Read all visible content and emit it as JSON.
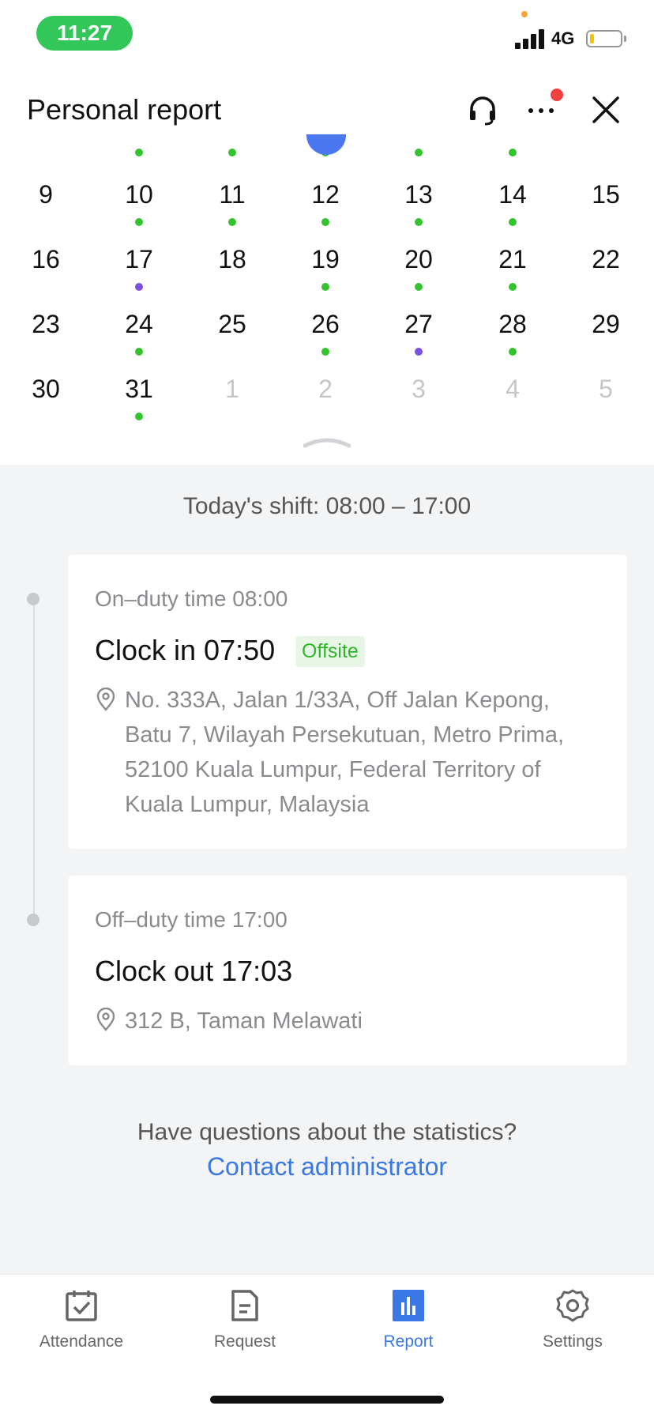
{
  "status_bar": {
    "time": "11:27",
    "network": "4G"
  },
  "header": {
    "title": "Personal report"
  },
  "calendar": {
    "rows": [
      [
        {
          "day": "9",
          "dot": null,
          "other": false
        },
        {
          "day": "10",
          "dot": "green",
          "other": false
        },
        {
          "day": "11",
          "dot": "green",
          "other": false
        },
        {
          "day": "12",
          "dot": "green",
          "other": false
        },
        {
          "day": "13",
          "dot": "green",
          "other": false
        },
        {
          "day": "14",
          "dot": "green",
          "other": false
        },
        {
          "day": "15",
          "dot": null,
          "other": false
        }
      ],
      [
        {
          "day": "16",
          "dot": null,
          "other": false
        },
        {
          "day": "17",
          "dot": "purple",
          "other": false
        },
        {
          "day": "18",
          "dot": null,
          "other": false
        },
        {
          "day": "19",
          "dot": "green",
          "other": false
        },
        {
          "day": "20",
          "dot": "green",
          "other": false
        },
        {
          "day": "21",
          "dot": "green",
          "other": false
        },
        {
          "day": "22",
          "dot": null,
          "other": false
        }
      ],
      [
        {
          "day": "23",
          "dot": null,
          "other": false
        },
        {
          "day": "24",
          "dot": "green",
          "other": false
        },
        {
          "day": "25",
          "dot": null,
          "other": false
        },
        {
          "day": "26",
          "dot": "green",
          "other": false
        },
        {
          "day": "27",
          "dot": "purple",
          "other": false
        },
        {
          "day": "28",
          "dot": "green",
          "other": false
        },
        {
          "day": "29",
          "dot": null,
          "other": false
        }
      ],
      [
        {
          "day": "30",
          "dot": null,
          "other": false
        },
        {
          "day": "31",
          "dot": "green",
          "other": false
        },
        {
          "day": "1",
          "dot": null,
          "other": true
        },
        {
          "day": "2",
          "dot": null,
          "other": true
        },
        {
          "day": "3",
          "dot": null,
          "other": true
        },
        {
          "day": "4",
          "dot": null,
          "other": true
        },
        {
          "day": "5",
          "dot": null,
          "other": true
        }
      ]
    ],
    "top_row_dots": [
      null,
      "green",
      "green",
      "green",
      "green",
      "green",
      null
    ]
  },
  "shift": {
    "text": "Today's shift: 08:00 – 17:00"
  },
  "records": [
    {
      "label": "On–duty time 08:00",
      "main": "Clock in 07:50",
      "badge": "Offsite",
      "address_lines": [
        "No. 333A, Jalan 1/33A, Off Jalan Kepong,",
        "Batu 7, Wilayah Persekutuan, Metro Prima,",
        "52100 Kuala Lumpur, Federal Territory of",
        "Kuala Lumpur, Malaysia"
      ]
    },
    {
      "label": "Off–duty time 17:00",
      "main": "Clock out 17:03",
      "address": "312 B, Taman Melawati"
    }
  ],
  "footer": {
    "question": "Have questions about the statistics?",
    "contact_link": "Contact administrator"
  },
  "tabs": [
    {
      "label": "Attendance",
      "icon": "calendar-check-icon",
      "active": false
    },
    {
      "label": "Request",
      "icon": "document-icon",
      "active": false
    },
    {
      "label": "Report",
      "icon": "bar-chart-icon",
      "active": true
    },
    {
      "label": "Settings",
      "icon": "gear-icon",
      "active": false
    }
  ],
  "colors": {
    "accent": "#3a78e6",
    "green": "#34c32e",
    "purple": "#7b4fe0",
    "status_pill": "#33c759"
  }
}
